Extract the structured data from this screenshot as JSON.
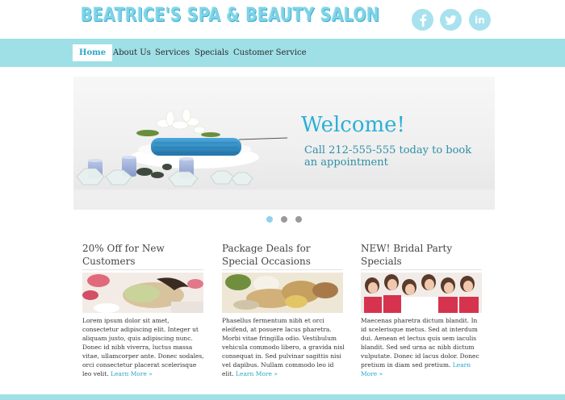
{
  "header": {
    "logo_text": "BEATRICE'S SPA & BEAUTY SALON",
    "social": [
      {
        "name": "facebook",
        "icon": "facebook-icon"
      },
      {
        "name": "twitter",
        "icon": "twitter-icon"
      },
      {
        "name": "linkedin",
        "icon": "linkedin-icon",
        "text": "in"
      }
    ]
  },
  "nav": {
    "items": [
      {
        "label": "Home",
        "active": true
      },
      {
        "label": "About Us"
      },
      {
        "label": "Services"
      },
      {
        "label": "Specials"
      },
      {
        "label": "Customer Service"
      }
    ]
  },
  "hero": {
    "title": "Welcome!",
    "subtitle": "Call 212-555-555 today to book an appointment",
    "slide_count": 3,
    "active_slide": 1
  },
  "columns": [
    {
      "title": "20% Off for New Customers",
      "text": "Lorem ipsum dolor sit amet, consectetur adipiscing elit. Integer ut aliquam justo, quis adipiscing nunc. Donec id nibh viverra, luctus massa vitae, ullamcorper ante. Donec sodales, orci consectetur placerat scelerisque leo velit.",
      "more": "Learn More »"
    },
    {
      "title": "Package Deals for Special Occasions",
      "text": "Phasellus fermentum nibh et orci eleifend, at posuere lacus pharetra. Morbi vitae fringilla odio. Vestibulum vehicula commodo libero, a gravida nisl consequat in. Sed pulvinar sagittis nisi vel dapibus. Nullam commodo leo id elit.",
      "more": "Learn More »"
    },
    {
      "title": "NEW! Bridal Party Specials",
      "text": "Maecenas pharetra dictum blandit. In id scelerisque metus. Sed at interdum dui. Aenean et lectus quis sem iaculis blandit. Sed sed urna ac nibh dictum vulputate. Donec id lacus dolor. Donec pretium in diam sed pretium.",
      "more": "Learn More »"
    }
  ],
  "colors": {
    "accent": "#9fe0e6",
    "link": "#2aa6c9",
    "hero_title": "#2bb0d6"
  }
}
